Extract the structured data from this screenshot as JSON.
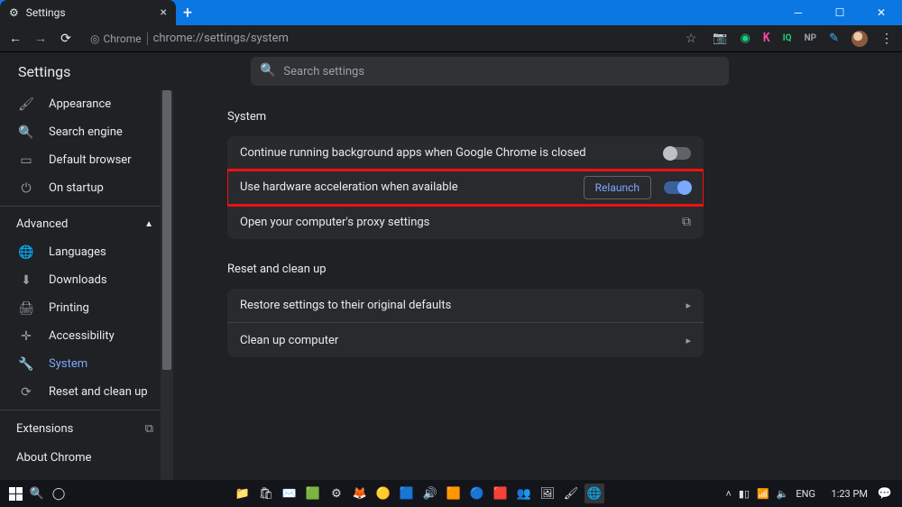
{
  "window": {
    "tab_title": "Settings",
    "new_tab_tooltip": "+"
  },
  "omnibox": {
    "secure_label": "Chrome",
    "url": "chrome://settings/system"
  },
  "app": {
    "title": "Settings",
    "search_placeholder": "Search settings"
  },
  "sidebar": {
    "items_top": [
      {
        "icon": "🖌",
        "label": "Appearance"
      },
      {
        "icon": "🔍",
        "label": "Search engine"
      },
      {
        "icon": "▭",
        "label": "Default browser"
      },
      {
        "icon": "⏻",
        "label": "On startup"
      }
    ],
    "advanced_label": "Advanced",
    "items_adv": [
      {
        "icon": "🌐",
        "label": "Languages"
      },
      {
        "icon": "⬇",
        "label": "Downloads"
      },
      {
        "icon": "🖨",
        "label": "Printing"
      },
      {
        "icon": "✛",
        "label": "Accessibility"
      },
      {
        "icon": "🔧",
        "label": "System",
        "active": true
      },
      {
        "icon": "⟳",
        "label": "Reset and clean up"
      }
    ],
    "extensions_label": "Extensions",
    "about_label": "About Chrome"
  },
  "content": {
    "section_system": "System",
    "row_bg_apps": "Continue running background apps when Google Chrome is closed",
    "row_hw_accel": "Use hardware acceleration when available",
    "relaunch": "Relaunch",
    "row_proxy": "Open your computer's proxy settings",
    "section_reset": "Reset and clean up",
    "row_restore": "Restore settings to their original defaults",
    "row_cleanup": "Clean up computer"
  },
  "taskbar": {
    "lang": "ENG",
    "time": "1:23 PM"
  }
}
